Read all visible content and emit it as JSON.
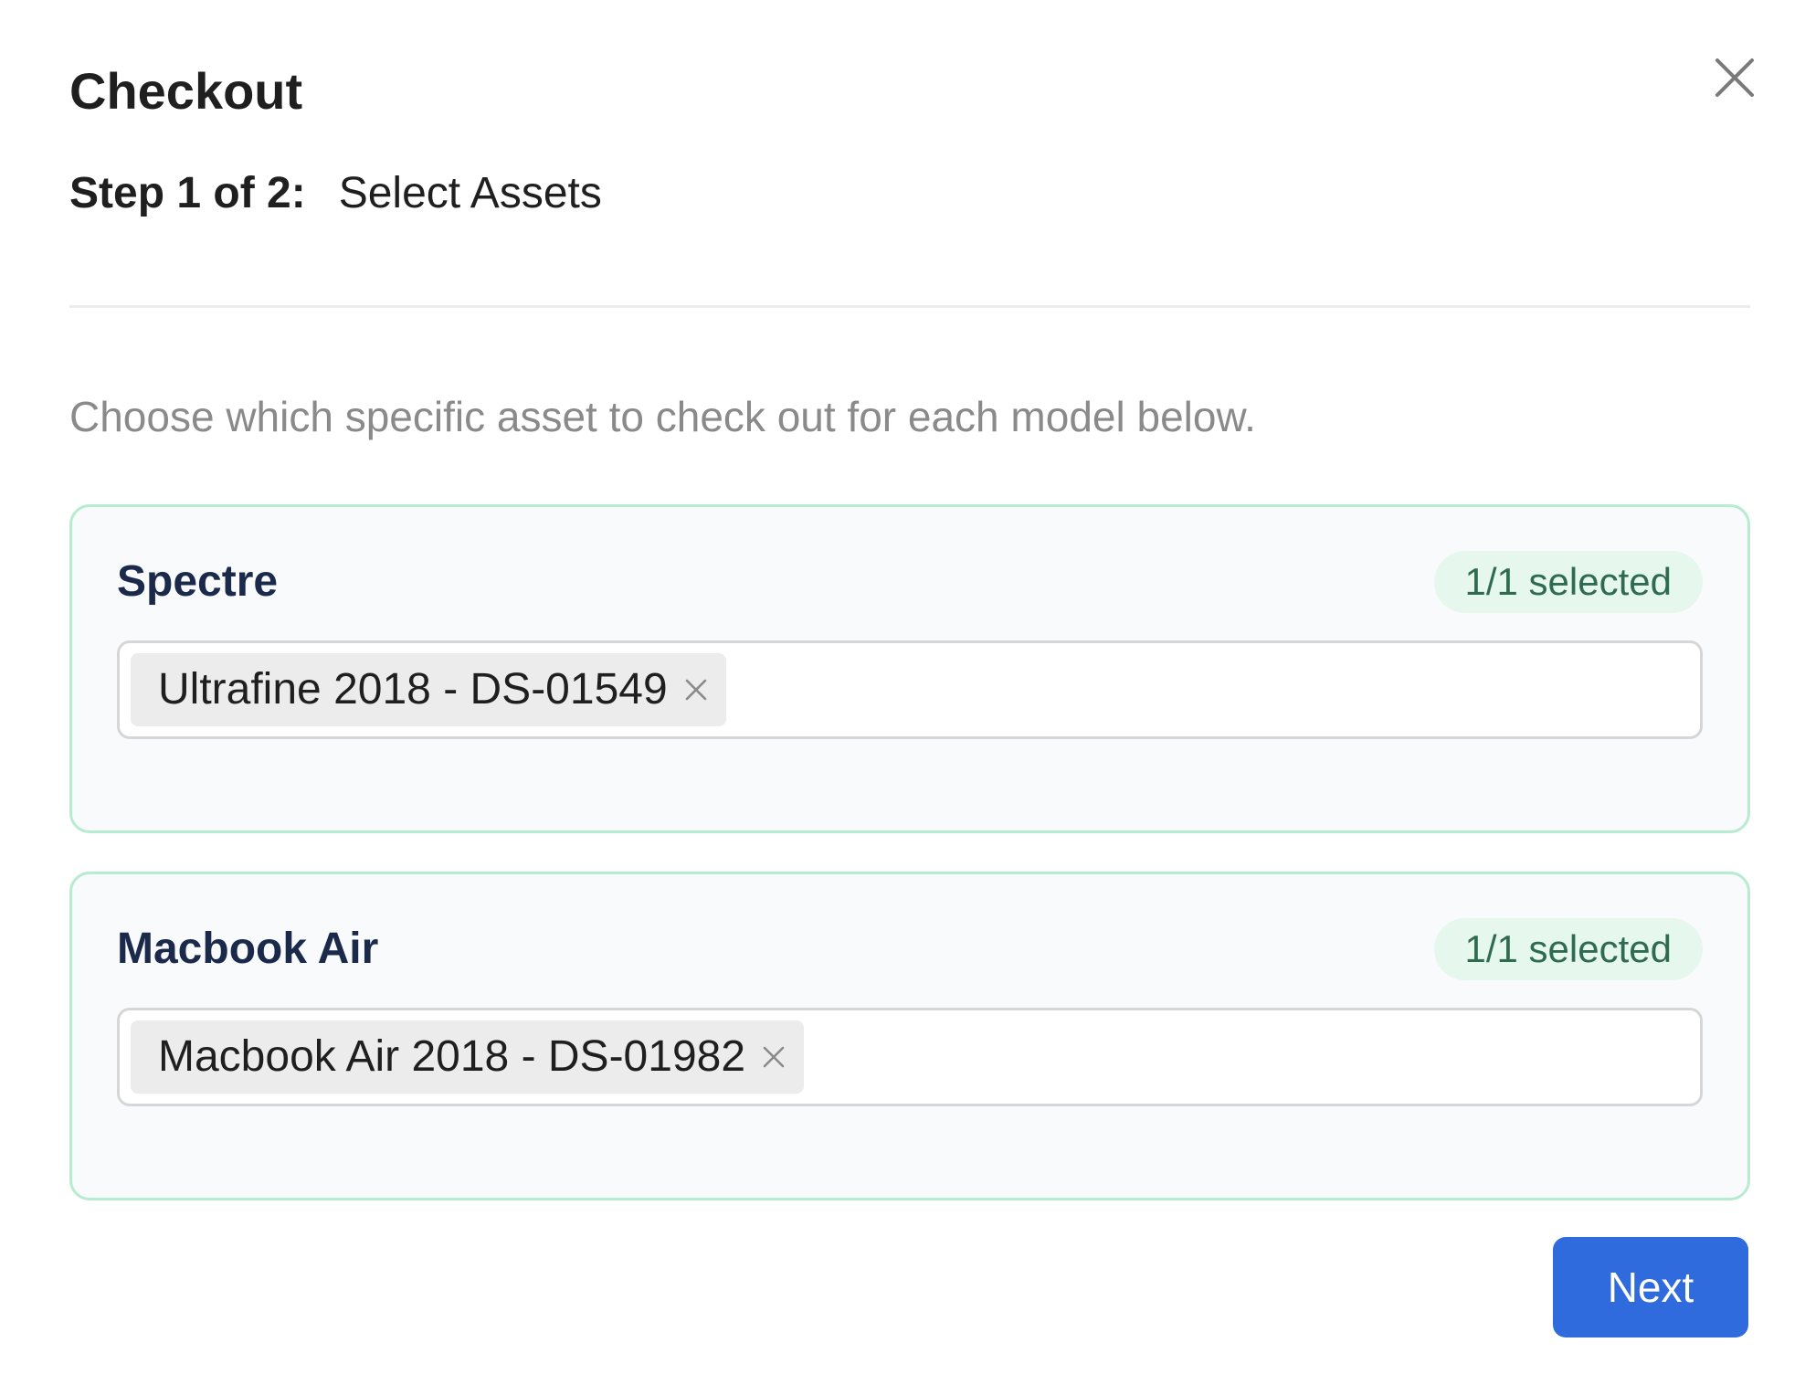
{
  "modal": {
    "title": "Checkout",
    "close_icon": "close-icon"
  },
  "step": {
    "label": "Step 1 of 2:",
    "name": "Select Assets"
  },
  "description": "Choose which specific asset to check out for each model below.",
  "models": [
    {
      "name": "Spectre",
      "badge": "1/1 selected",
      "selected_assets": [
        "Ultrafine 2018 - DS-01549"
      ]
    },
    {
      "name": "Macbook Air",
      "badge": "1/1 selected",
      "selected_assets": [
        "Macbook Air 2018 - DS-01982"
      ]
    }
  ],
  "footer": {
    "next_label": "Next"
  },
  "colors": {
    "accent": "#2f6bdc",
    "card_border": "#b7ecd1",
    "badge_bg": "#e6f7ee",
    "badge_text": "#2e6b4f",
    "model_title": "#1b2a4a"
  }
}
